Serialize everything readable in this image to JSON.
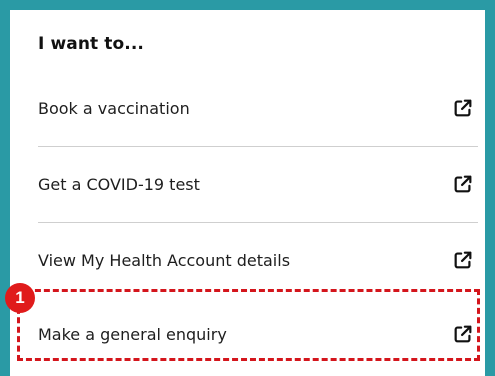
{
  "panel": {
    "heading": "I want to...",
    "items": [
      {
        "label": "Book a vaccination",
        "icon": "external-link-icon"
      },
      {
        "label": "Get a COVID-19 test",
        "icon": "external-link-icon"
      },
      {
        "label": "View My Health Account details",
        "icon": "external-link-icon"
      },
      {
        "label": "Make a general enquiry",
        "icon": "external-link-icon"
      }
    ]
  },
  "annotation": {
    "step_number": "1",
    "highlight_color": "#d4151c"
  },
  "colors": {
    "frame": "#2a9aa5",
    "text": "#1e1e1e",
    "divider": "#cfcfcf"
  }
}
